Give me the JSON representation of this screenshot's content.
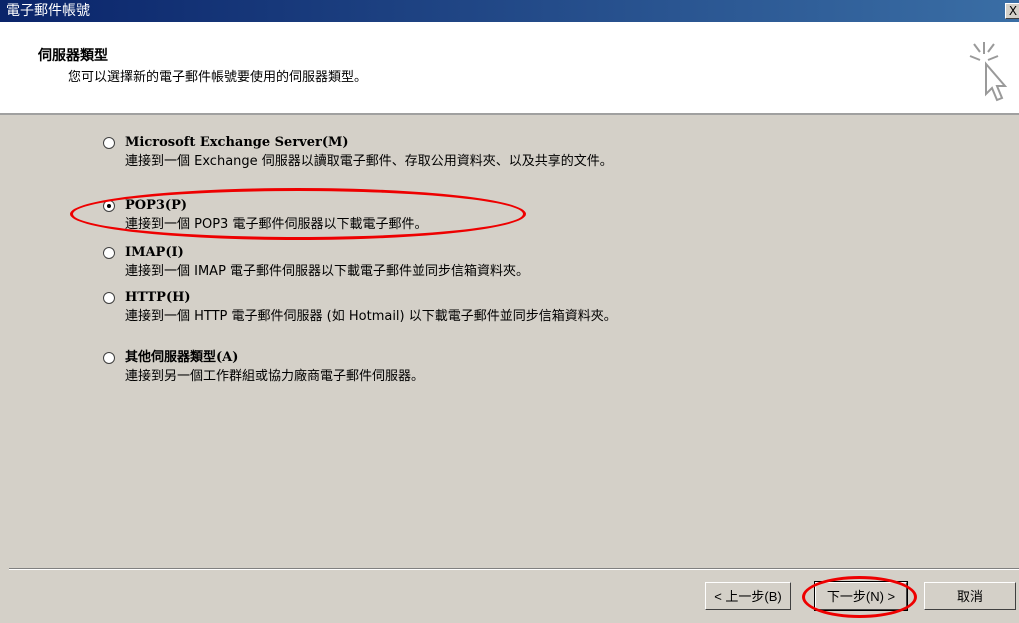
{
  "window": {
    "title": "電子郵件帳號",
    "close_label": "X"
  },
  "header": {
    "title": "伺服器類型",
    "subtitle": "您可以選擇新的電子郵件帳號要使用的伺服器類型。",
    "icon": "wizard-cursor-icon"
  },
  "options": [
    {
      "label": "Microsoft Exchange Server(M)",
      "description": "連接到一個 Exchange 伺服器以讀取電子郵件、存取公用資料夾、以及共享的文件。",
      "selected": false
    },
    {
      "label": "POP3(P)",
      "description": "連接到一個 POP3 電子郵件伺服器以下載電子郵件。",
      "selected": true
    },
    {
      "label": "IMAP(I)",
      "description": "連接到一個 IMAP 電子郵件伺服器以下載電子郵件並同步信箱資料夾。",
      "selected": false
    },
    {
      "label": "HTTP(H)",
      "description": "連接到一個 HTTP 電子郵件伺服器 (如 Hotmail) 以下載電子郵件並同步信箱資料夾。",
      "selected": false
    },
    {
      "label": "其他伺服器類型(A)",
      "description": "連接到另一個工作群組或協力廠商電子郵件伺服器。",
      "selected": false
    }
  ],
  "buttons": {
    "back": "< 上一步(B)",
    "next": "下一步(N) >",
    "cancel": "取消"
  },
  "colors": {
    "title_bar": "#0a246a",
    "dialog_bg": "#d4d0c8",
    "annotation": "#e00000"
  }
}
